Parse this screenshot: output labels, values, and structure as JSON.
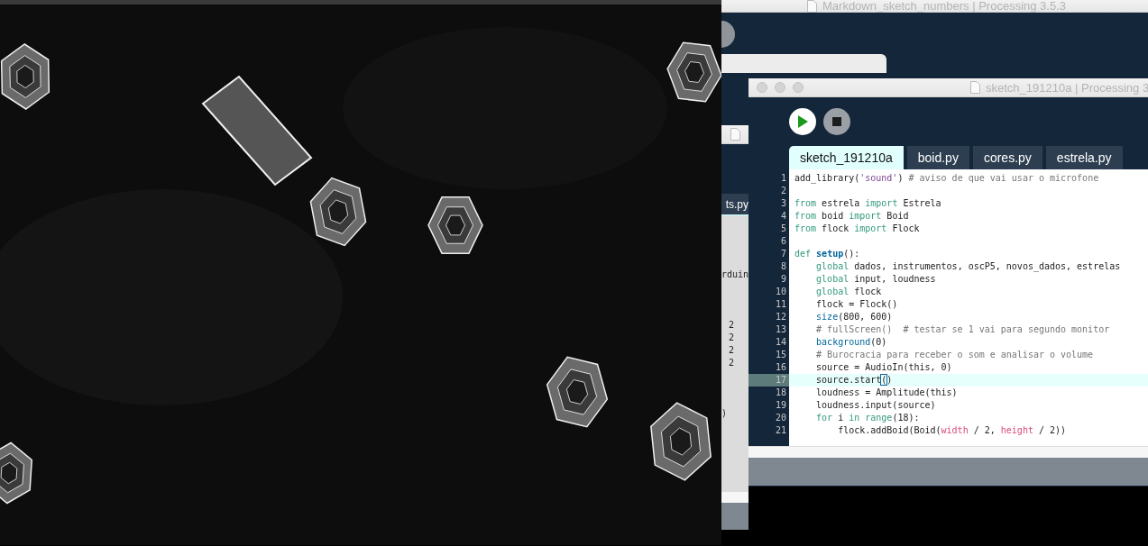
{
  "back_window": {
    "title": "Markdown_sketch_numbers | Processing 3.5.3"
  },
  "side_window": {
    "tab": "ts.py",
    "code_fragments": [
      "rduin",
      "2",
      "2",
      "2",
      "2",
      ")"
    ]
  },
  "front_window": {
    "title": "sketch_191210a | Processing 3",
    "tabs": [
      {
        "label": "sketch_191210a",
        "selected": true
      },
      {
        "label": "boid.py",
        "selected": false
      },
      {
        "label": "cores.py",
        "selected": false
      },
      {
        "label": "estrela.py",
        "selected": false
      }
    ],
    "code_lines": [
      {
        "number": "1",
        "current": false,
        "tokens": [
          {
            "kind": "plain",
            "text": "add_library("
          },
          {
            "kind": "string",
            "text": "'sound'"
          },
          {
            "kind": "plain",
            "text": ") "
          },
          {
            "kind": "comment",
            "text": "# aviso de que vai usar o microfone"
          }
        ]
      },
      {
        "number": "2",
        "current": false
      },
      {
        "number": "3",
        "current": false,
        "tokens": [
          {
            "kind": "keyword",
            "text": "from"
          },
          {
            "kind": "plain",
            "text": " estrela "
          },
          {
            "kind": "keyword",
            "text": "import"
          },
          {
            "kind": "plain",
            "text": " Estrela"
          }
        ]
      },
      {
        "number": "4",
        "current": false,
        "tokens": [
          {
            "kind": "keyword",
            "text": "from"
          },
          {
            "kind": "plain",
            "text": " boid "
          },
          {
            "kind": "keyword",
            "text": "import"
          },
          {
            "kind": "plain",
            "text": " Boid"
          }
        ]
      },
      {
        "number": "5",
        "current": false,
        "tokens": [
          {
            "kind": "keyword",
            "text": "from"
          },
          {
            "kind": "plain",
            "text": " flock "
          },
          {
            "kind": "keyword",
            "text": "import"
          },
          {
            "kind": "plain",
            "text": " Flock"
          }
        ]
      },
      {
        "number": "6",
        "current": false
      },
      {
        "number": "7",
        "current": false,
        "tokens": [
          {
            "kind": "keyword",
            "text": "def "
          },
          {
            "kind": "function",
            "text": "setup"
          },
          {
            "kind": "plain",
            "text": "():"
          }
        ]
      },
      {
        "number": "8",
        "current": false,
        "tokens": [
          {
            "kind": "keyword",
            "text": "    global"
          },
          {
            "kind": "plain",
            "text": " dados, instrumentos, oscP5, novos_dados, estrelas"
          }
        ]
      },
      {
        "number": "9",
        "current": false,
        "tokens": [
          {
            "kind": "keyword",
            "text": "    global"
          },
          {
            "kind": "plain",
            "text": " input, loudness"
          }
        ]
      },
      {
        "number": "10",
        "current": false,
        "tokens": [
          {
            "kind": "keyword",
            "text": "    global"
          },
          {
            "kind": "plain",
            "text": " flock"
          }
        ]
      },
      {
        "number": "11",
        "current": false,
        "tokens": [
          {
            "kind": "plain",
            "text": "    flock = Flock()"
          }
        ]
      },
      {
        "number": "12",
        "current": false,
        "tokens": [
          {
            "kind": "builtin",
            "text": "    size"
          },
          {
            "kind": "plain",
            "text": "(800, 600)"
          }
        ]
      },
      {
        "number": "13",
        "current": false,
        "tokens": [
          {
            "kind": "comment",
            "text": "    # fullScreen()  # testar se 1 vai para segundo monitor"
          }
        ]
      },
      {
        "number": "14",
        "current": false,
        "tokens": [
          {
            "kind": "builtin",
            "text": "    background"
          },
          {
            "kind": "plain",
            "text": "(0)"
          }
        ]
      },
      {
        "number": "15",
        "current": false,
        "tokens": [
          {
            "kind": "comment",
            "text": "    # Burocracia para receber o som e analisar o volume"
          }
        ]
      },
      {
        "number": "16",
        "current": false,
        "tokens": [
          {
            "kind": "plain",
            "text": "    source = AudioIn(this, 0)"
          }
        ]
      },
      {
        "number": "17",
        "current": true,
        "tokens": [
          {
            "kind": "plain",
            "text": "    source.start"
          },
          {
            "kind": "cursor",
            "text": "("
          },
          {
            "kind": "plain",
            "text": ")"
          }
        ]
      },
      {
        "number": "18",
        "current": false,
        "tokens": [
          {
            "kind": "plain",
            "text": "    loudness = Amplitude(this)"
          }
        ]
      },
      {
        "number": "19",
        "current": false,
        "tokens": [
          {
            "kind": "plain",
            "text": "    loudness.input(source)"
          }
        ]
      },
      {
        "number": "20",
        "current": false,
        "tokens": [
          {
            "kind": "keyword",
            "text": "    for"
          },
          {
            "kind": "plain",
            "text": " i "
          },
          {
            "kind": "keyword",
            "text": "in range"
          },
          {
            "kind": "plain",
            "text": "(18):"
          }
        ]
      },
      {
        "number": "21",
        "current": false,
        "tokens": [
          {
            "kind": "plain",
            "text": "        flock.addBoid(Boid("
          },
          {
            "kind": "constant",
            "text": "width"
          },
          {
            "kind": "plain",
            "text": " / 2, "
          },
          {
            "kind": "constant",
            "text": "height"
          },
          {
            "kind": "plain",
            "text": " / 2))"
          }
        ]
      }
    ]
  }
}
